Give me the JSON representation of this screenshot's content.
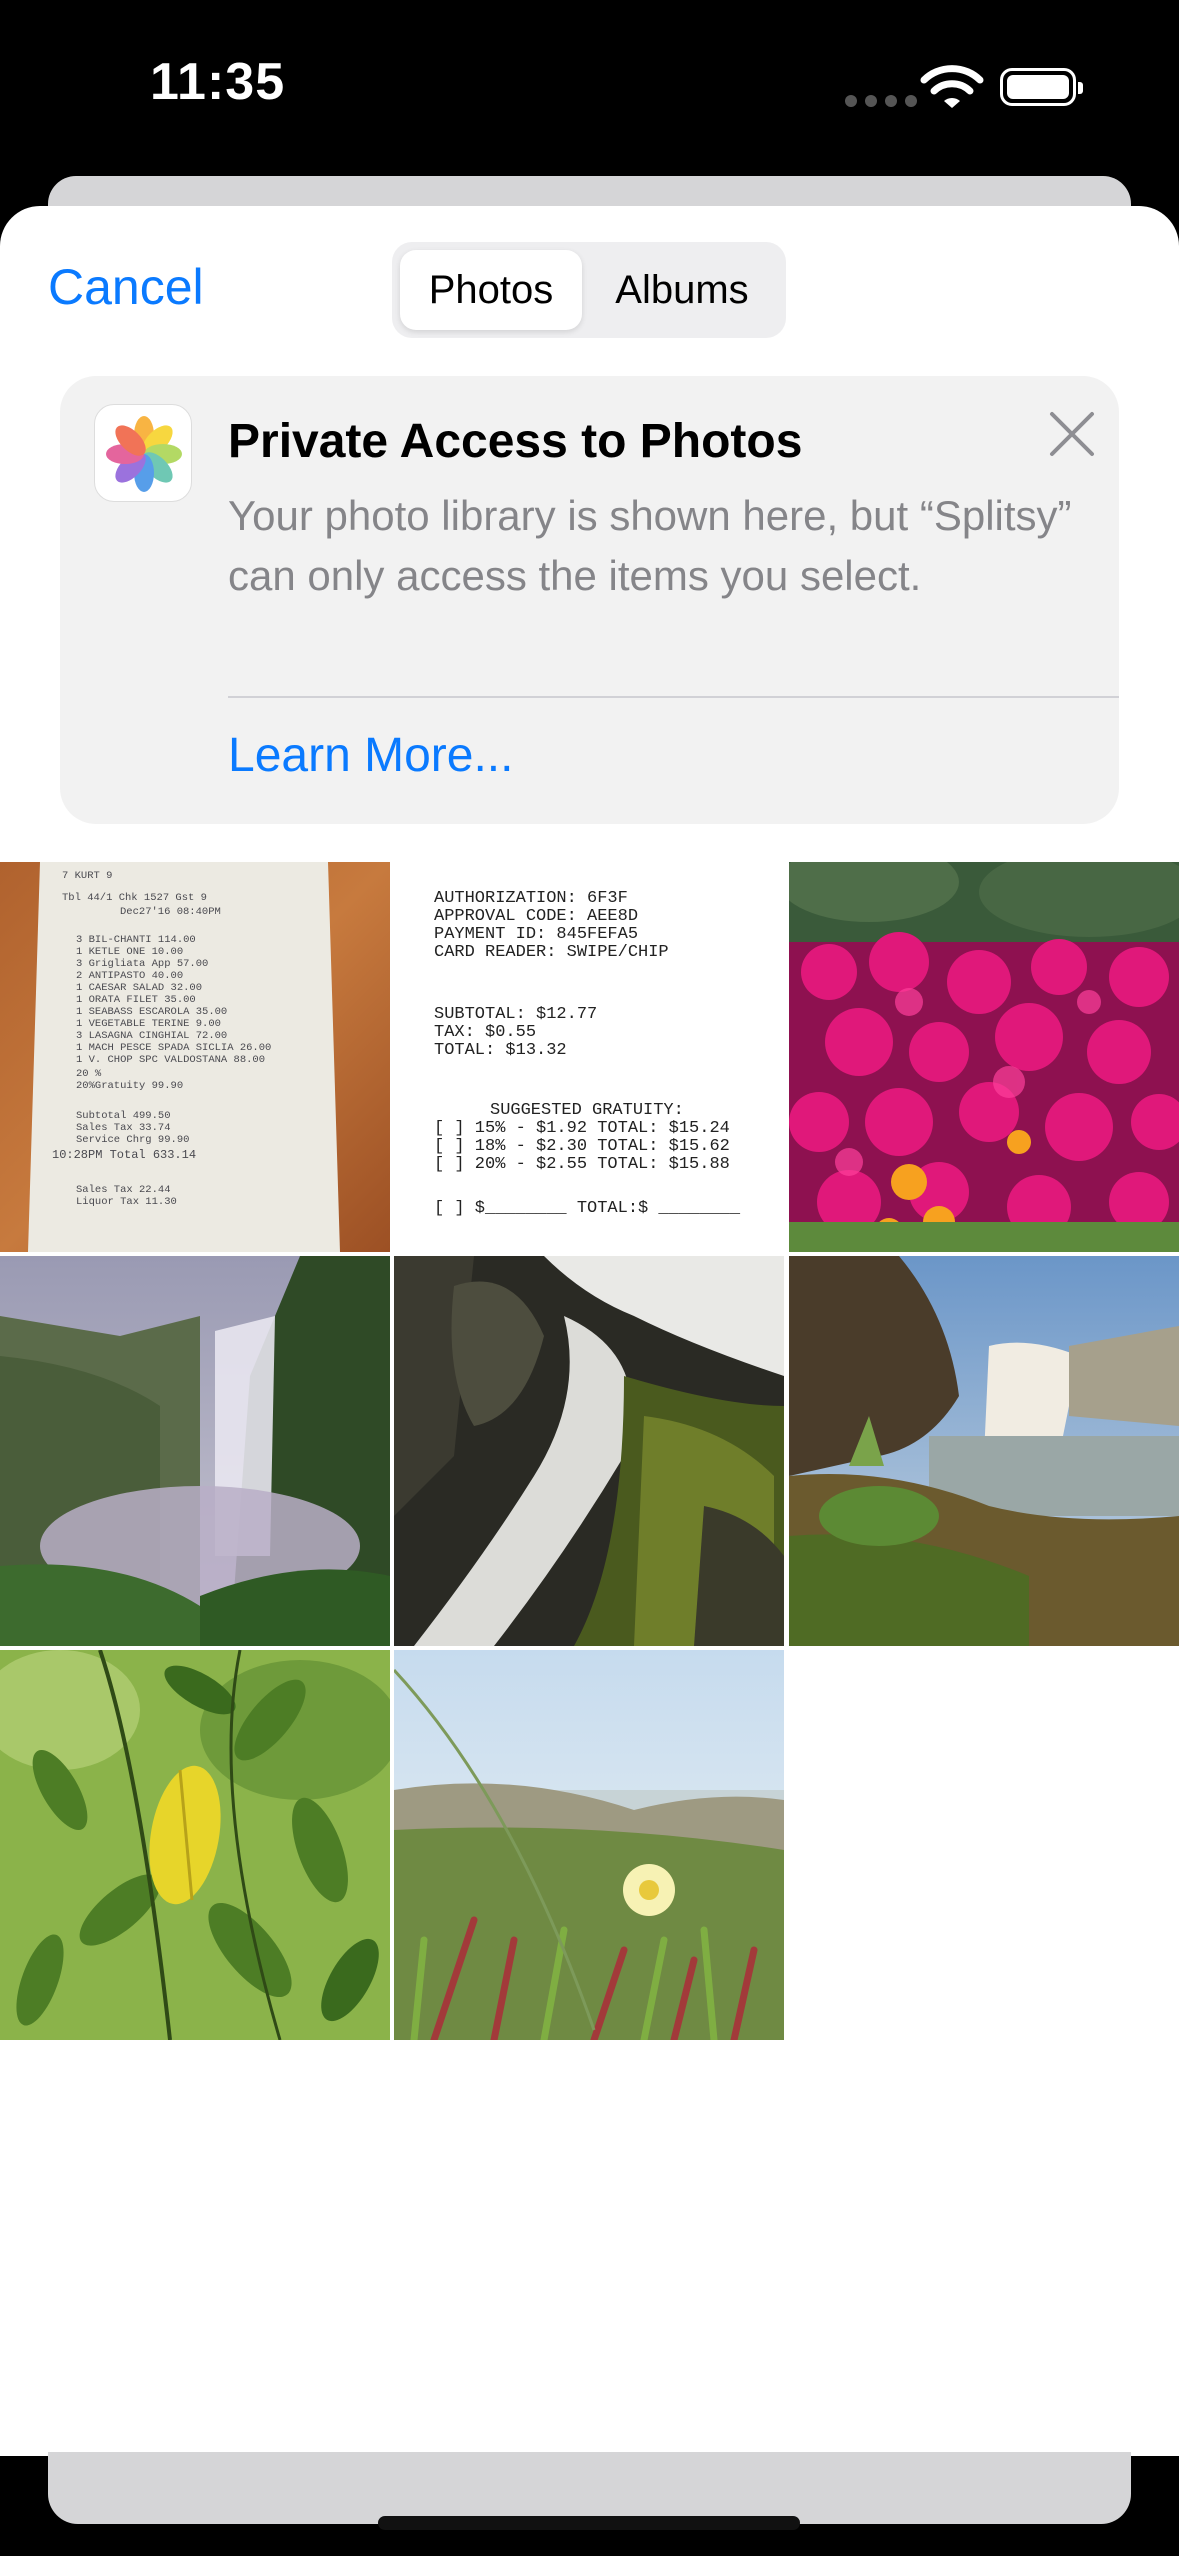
{
  "status_bar": {
    "time": "11:35"
  },
  "header": {
    "cancel_label": "Cancel",
    "tabs": [
      "Photos",
      "Albums"
    ],
    "selected_tab": "Photos"
  },
  "banner": {
    "icon": "photos-app-icon",
    "title": "Private Access to Photos",
    "body": "Your photo library is shown here, but “Splitsy” can only access the items you select.",
    "link": "Learn More..."
  },
  "receipt_photo": {
    "lines": [
      "7 KURT 9",
      "Tbl 44/1     Chk 1527     Gst 9",
      "Dec27'16 08:40PM",
      "3 BIL-CHANTI          114.00",
      "1 KETLE ONE            10.00",
      "3 Grigliata App        57.00",
      "2 ANTIPASTO            40.00",
      "1 CAESAR SALAD         32.00",
      "1 ORATA FILET          35.00",
      "1 SEABASS ESCAROLA     35.00",
      "1 VEGETABLE TERINE      9.00",
      "3 LASAGNA CINGHIAL     72.00",
      "1 MACH PESCE SPADA SICLIA 26.00",
      "1 V. CHOP SPC VALDOSTANA 88.00",
      "20 %",
      "20%Gratuity            99.90",
      "Subtotal              499.50",
      "Sales Tax              33.74",
      "Service Chrg           99.90",
      "10:28PM Total         633.14",
      "Sales Tax              22.44",
      "Liquor Tax             11.30"
    ]
  },
  "card_receipt_photo": {
    "auth_lines": [
      "AUTHORIZATION:         6F3F",
      "APPROVAL CODE:       AEE8D",
      "PAYMENT ID:        845FEFA5",
      "CARD READER:     SWIPE/CHIP"
    ],
    "total_lines": [
      "SUBTOTAL:            $12.77",
      "TAX:                  $0.55",
      "TOTAL:               $13.32"
    ],
    "gratuity_heading": "SUGGESTED GRATUITY:",
    "gratuity_lines": [
      "[ ] 15% - $1.92  TOTAL: $15.24",
      "[ ] 18% - $2.30  TOTAL: $15.62",
      "[ ] 20% - $2.55  TOTAL: $15.88"
    ],
    "custom_line": "[ ] $________  TOTAL:$ ________"
  },
  "photos": [
    {
      "subject": "restaurant-receipt"
    },
    {
      "subject": "card-receipt"
    },
    {
      "subject": "pink-flowers"
    },
    {
      "subject": "waterfall-cliff"
    },
    {
      "subject": "waterfall-closeup"
    },
    {
      "subject": "waterfall-coast"
    },
    {
      "subject": "green-leaves"
    },
    {
      "subject": "beach-flower"
    }
  ]
}
